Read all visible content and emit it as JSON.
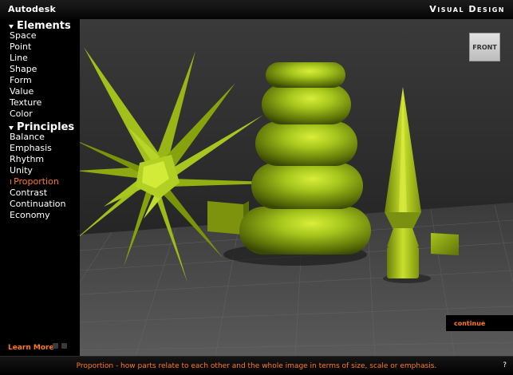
{
  "header": {
    "brand": "Autodesk",
    "title": "Visual Design"
  },
  "sidebar": {
    "elements_heading": "Elements",
    "elements": [
      {
        "label": "Space"
      },
      {
        "label": "Point"
      },
      {
        "label": "Line"
      },
      {
        "label": "Shape"
      },
      {
        "label": "Form"
      },
      {
        "label": "Value"
      },
      {
        "label": "Texture"
      },
      {
        "label": "Color"
      }
    ],
    "principles_heading": "Principles",
    "principles": [
      {
        "label": "Balance"
      },
      {
        "label": "Emphasis"
      },
      {
        "label": "Rhythm"
      },
      {
        "label": "Unity"
      },
      {
        "label": "Proportion",
        "active": true
      },
      {
        "label": "Contrast"
      },
      {
        "label": "Continuation"
      },
      {
        "label": "Economy"
      }
    ],
    "learn_more": "Learn More"
  },
  "viewport": {
    "front_label": "FRONT",
    "continue_label": "continue"
  },
  "footer": {
    "caption": "Proportion - how parts relate to each other and the whole image in terms of size, scale or emphasis.",
    "help": "?"
  },
  "colors": {
    "accent": "#ff7a1a",
    "object_green": "#9cc21a"
  }
}
